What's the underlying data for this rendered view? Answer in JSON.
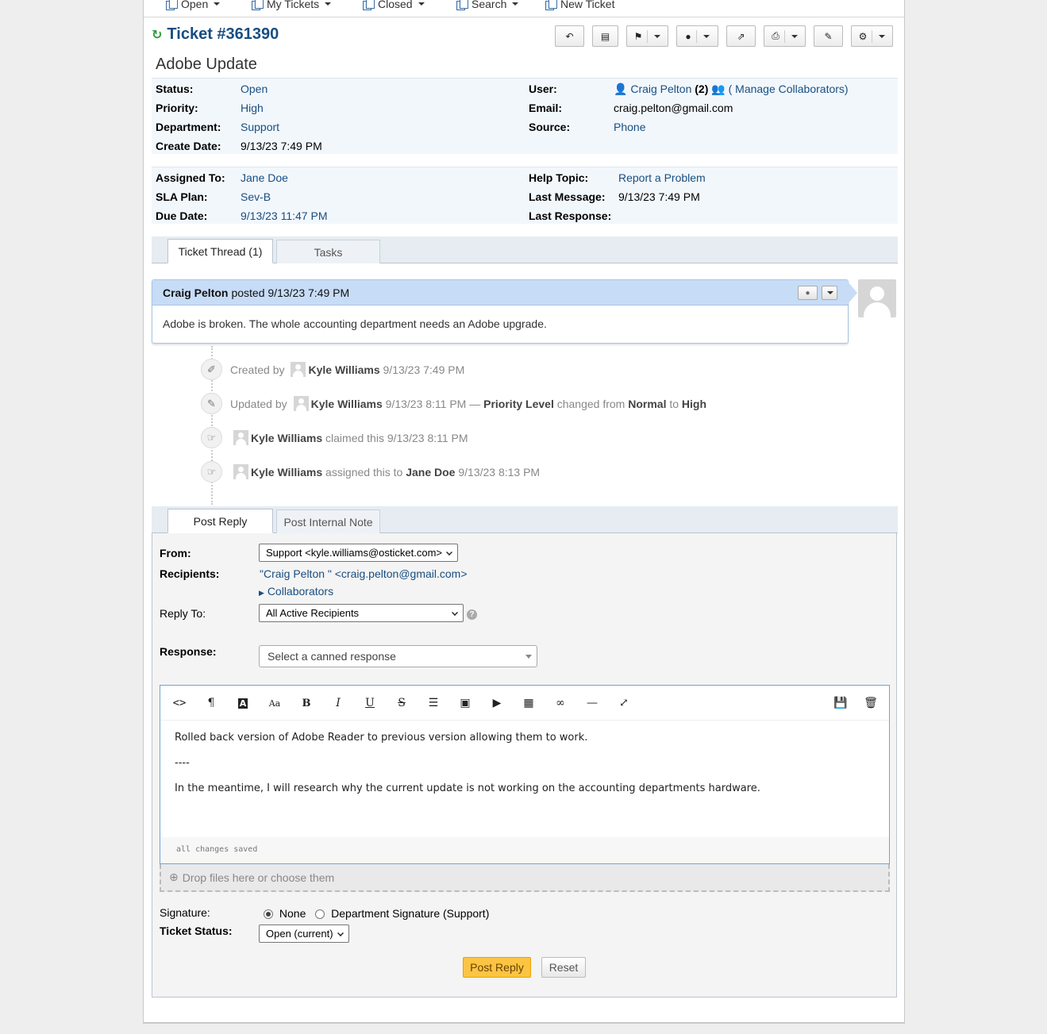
{
  "nav": {
    "open": "Open",
    "my_tickets": "My Tickets",
    "closed": "Closed",
    "search": "Search",
    "new_ticket": "New Ticket"
  },
  "ticket": {
    "number": "Ticket #361390",
    "subject": "Adobe Update"
  },
  "info": {
    "status_label": "Status:",
    "status": "Open",
    "priority_label": "Priority:",
    "priority": "High",
    "department_label": "Department:",
    "department": "Support",
    "create_label": "Create Date:",
    "create_date": "9/13/23 7:49 PM",
    "user_label": "User:",
    "user": "Craig Pelton",
    "user_count": "(2)",
    "collaborators_link": "( Manage Collaborators)",
    "email_label": "Email:",
    "email": "craig.pelton@gmail.com",
    "source_label": "Source:",
    "source": "Phone",
    "assigned_label": "Assigned To:",
    "assigned": "Jane Doe",
    "sla_label": "SLA Plan:",
    "sla": "Sev-B",
    "due_label": "Due Date:",
    "due": "9/13/23 11:47 PM",
    "help_label": "Help Topic:",
    "help": "Report a Problem",
    "last_msg_label": "Last Message:",
    "last_msg": "9/13/23 7:49 PM",
    "last_resp_label": "Last Response:",
    "last_resp": ""
  },
  "tabs": {
    "thread": "Ticket Thread (1)",
    "tasks": "Tasks"
  },
  "thread": {
    "author": "Craig Pelton",
    "posted": "posted 9/13/23 7:49 PM",
    "body": "Adobe is broken. The whole accounting department needs an Adobe upgrade."
  },
  "events": [
    {
      "pre": "Created by",
      "who": "Kyle Williams",
      "post": "9/13/23 7:49 PM"
    },
    {
      "pre": "Updated by",
      "who": "Kyle Williams",
      "post": "9/13/23 8:11 PM —",
      "field": "Priority Level",
      "mid": "changed from",
      "from": "Normal",
      "to_word": "to",
      "to": "High"
    },
    {
      "who": "Kyle Williams",
      "post": "claimed this 9/13/23 8:11 PM"
    },
    {
      "who": "Kyle Williams",
      "mid": "assigned this to",
      "target": "Jane Doe",
      "post": "9/13/23 8:13 PM"
    }
  ],
  "reply_tabs": {
    "post_reply": "Post Reply",
    "internal_note": "Post Internal Note"
  },
  "reply": {
    "from_label": "From:",
    "from_value": "Support <kyle.williams@osticket.com>",
    "recipients_label": "Recipients:",
    "recipients": "\"Craig Pelton \" <craig.pelton@gmail.com>",
    "collaborators": "Collaborators",
    "reply_to_label": "Reply To:",
    "reply_to_value": "All Active Recipients",
    "response_label": "Response:",
    "canned_placeholder": "Select a canned response",
    "editor_lines": [
      "Rolled back version of Adobe Reader to previous version allowing them to work.",
      "----",
      "In the meantime, I will research why the current update is not working on the accounting departments hardware."
    ],
    "editor_status": "all changes saved",
    "dropzone": "Drop files here or choose them",
    "signature_label": "Signature:",
    "sig_none": "None",
    "sig_dept": "Department Signature (Support)",
    "status_label": "Ticket Status:",
    "status_value": "Open (current)",
    "post_button": "Post Reply",
    "reset_button": "Reset"
  }
}
